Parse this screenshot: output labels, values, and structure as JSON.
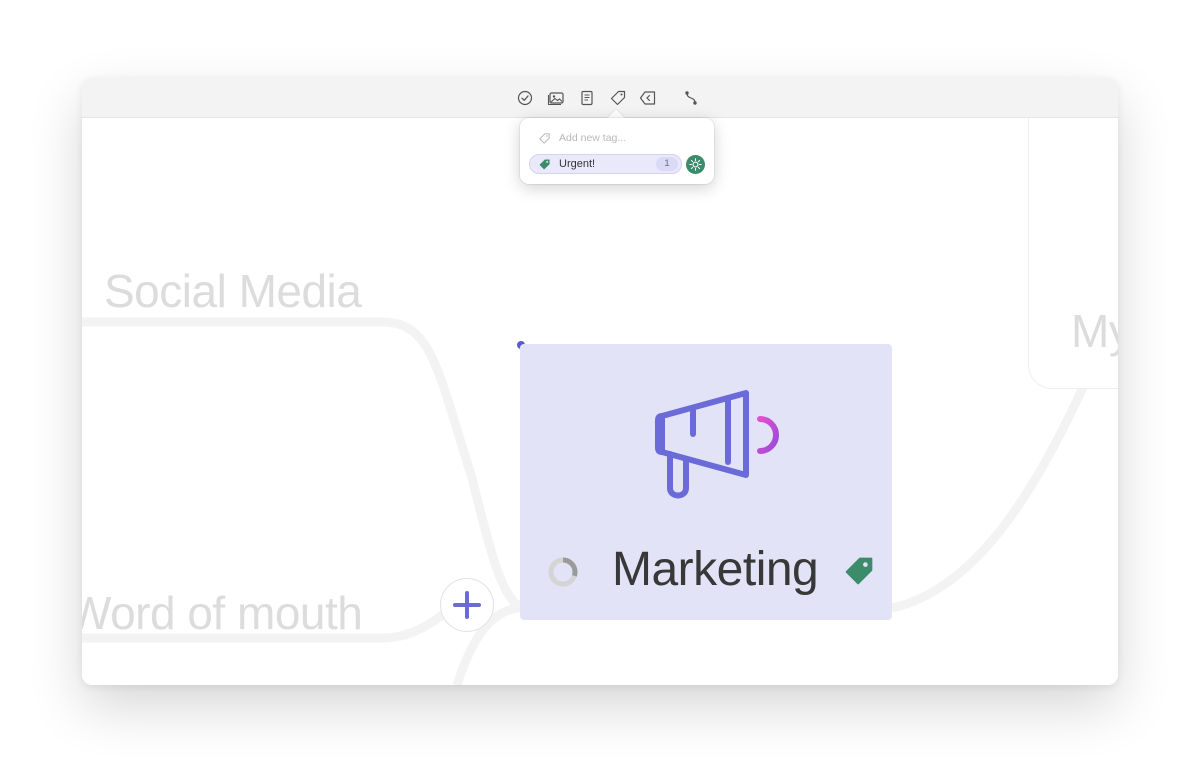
{
  "toolbar": {
    "items": [
      {
        "name": "task-check-icon"
      },
      {
        "name": "image-icon"
      },
      {
        "name": "note-icon"
      },
      {
        "name": "tag-icon"
      },
      {
        "name": "back-arrow-icon"
      },
      {
        "name": "connection-icon"
      }
    ]
  },
  "tag_popover": {
    "placeholder": "Add new tag...",
    "tags": [
      {
        "label": "Urgent!",
        "count": "1",
        "color": "#3c8c6c"
      }
    ]
  },
  "canvas": {
    "nodes": [
      {
        "label": "Social Media"
      },
      {
        "label": "Word of mouth"
      },
      {
        "label": "My"
      }
    ],
    "selected_node": {
      "title": "Marketing",
      "icon": "megaphone-icon",
      "accent_color": "#6a6ad8",
      "fill_color": "#e3e3f7",
      "tag_color": "#3c8c6c",
      "progress": 0.3
    }
  }
}
